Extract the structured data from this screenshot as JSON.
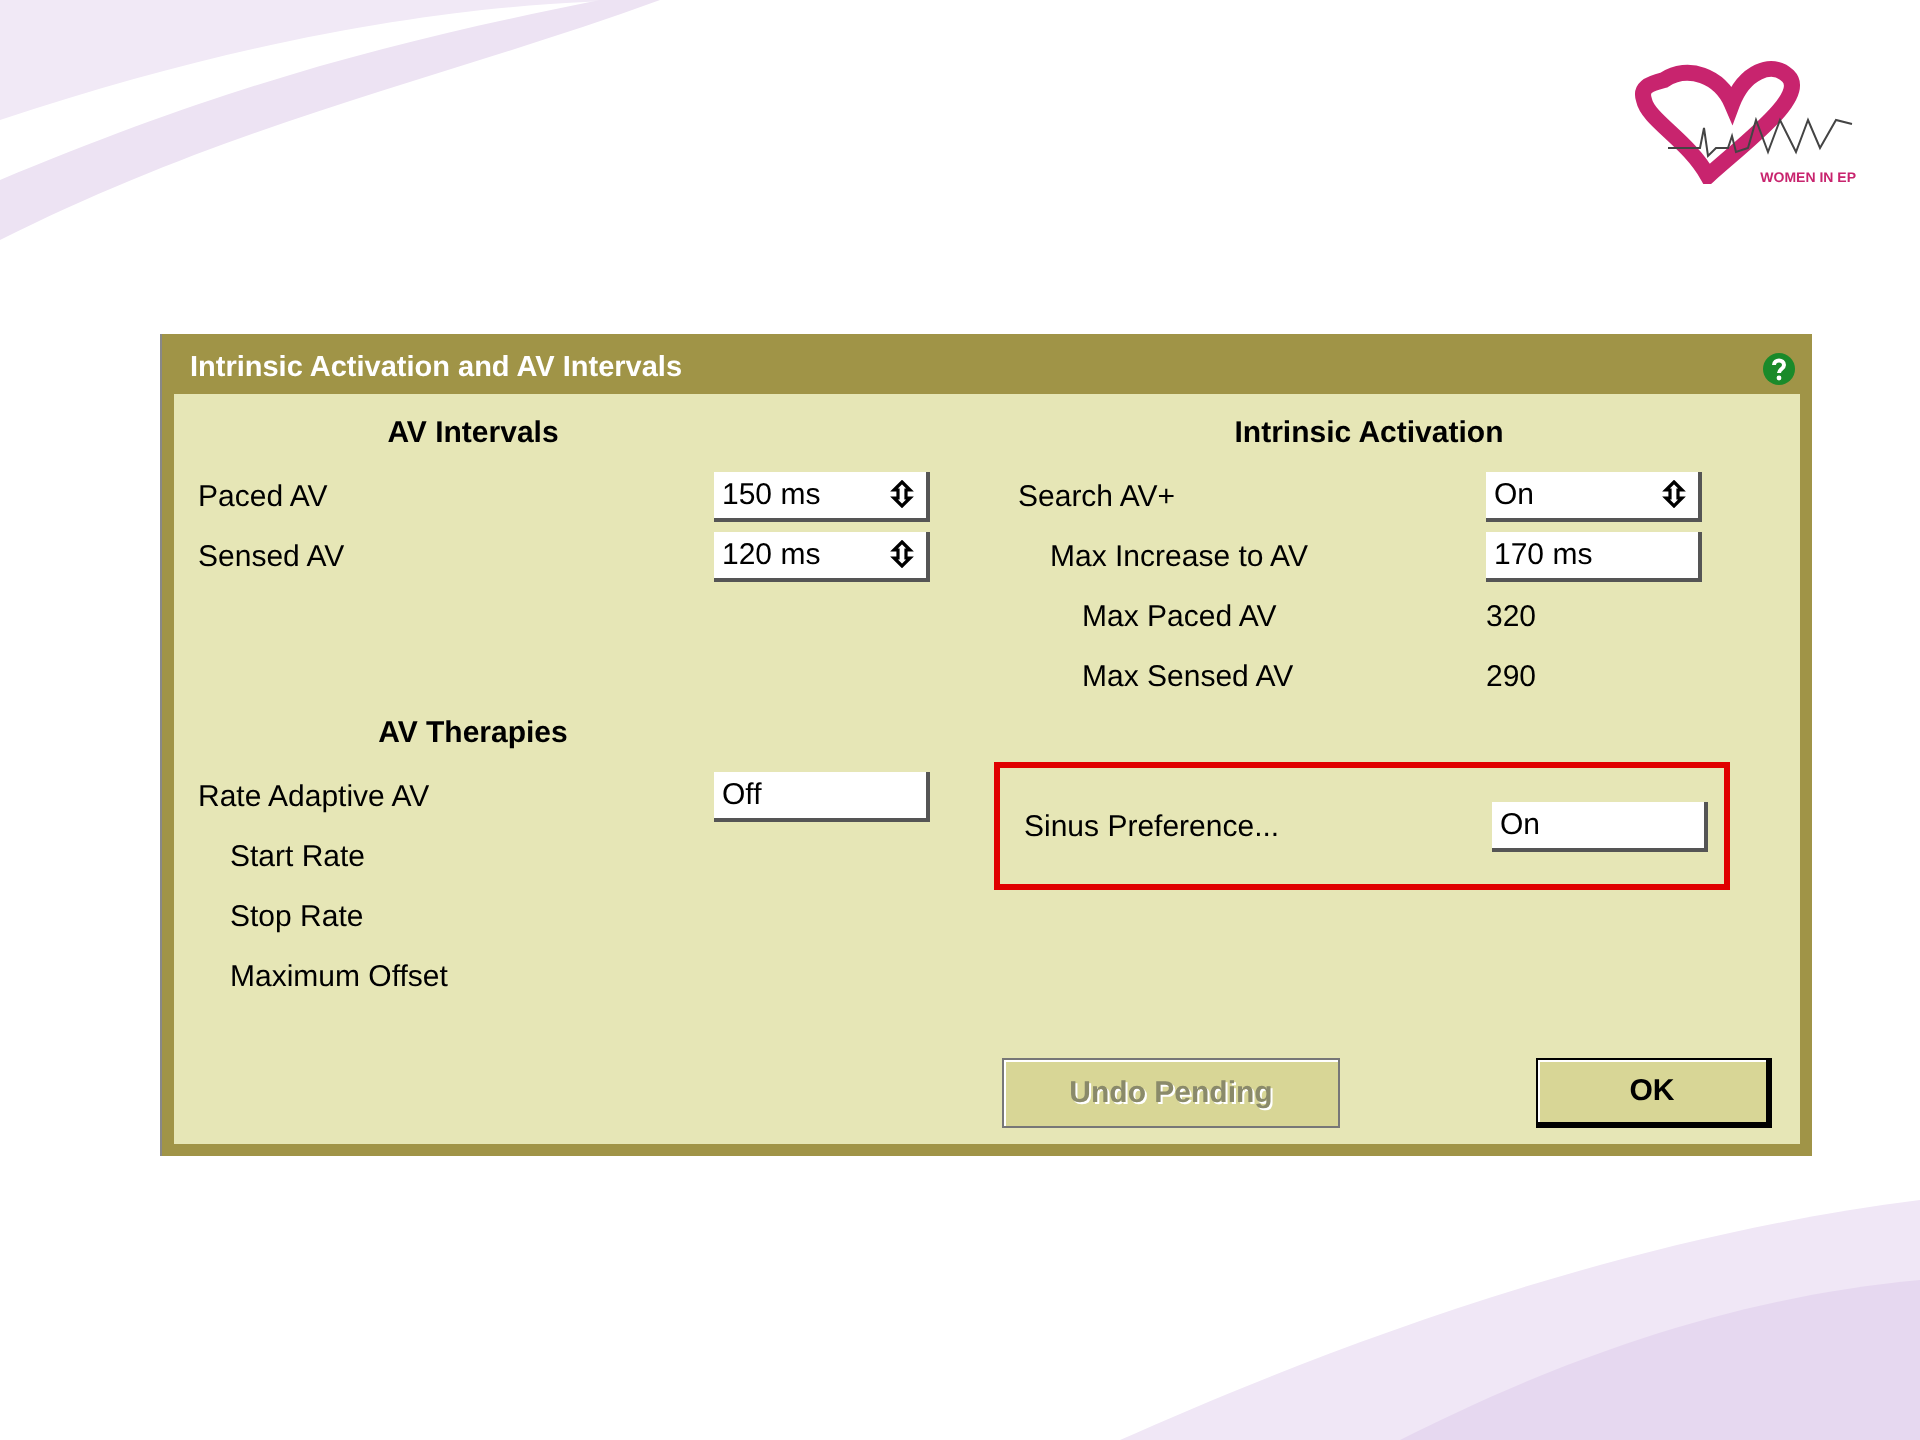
{
  "logo": {
    "caption": "WOMEN IN EP"
  },
  "window": {
    "title": "Intrinsic Activation and AV Intervals",
    "help": true
  },
  "columns": [
    {
      "groups": [
        {
          "heading": "AV Intervals",
          "highlighted": false,
          "rows": [
            {
              "kind": "field",
              "label": "Paced AV",
              "value": "150 ms",
              "spinner": true
            },
            {
              "kind": "field",
              "label": "Sensed AV",
              "value": "120 ms",
              "spinner": true
            }
          ]
        },
        {
          "heading": "AV Therapies",
          "highlighted": false,
          "rows": [
            {
              "kind": "field",
              "label": "Rate Adaptive AV",
              "value": "Off",
              "spinner": false,
              "children": [
                {
                  "kind": "label",
                  "label": "Start Rate"
                },
                {
                  "kind": "label",
                  "label": "Stop Rate"
                },
                {
                  "kind": "label",
                  "label": "Maximum Offset"
                }
              ]
            }
          ]
        }
      ]
    },
    {
      "groups": [
        {
          "heading": "Intrinsic Activation",
          "highlighted": false,
          "rows": [
            {
              "kind": "field",
              "label": "Search AV+",
              "value": "On",
              "spinner": true,
              "children": [
                {
                  "kind": "field",
                  "label": "Max Increase to AV",
                  "value": "170 ms",
                  "spinner": false,
                  "children": [
                    {
                      "kind": "readout",
                      "label": "Max Paced AV",
                      "value": "320"
                    },
                    {
                      "kind": "readout",
                      "label": "Max Sensed AV",
                      "value": "290"
                    }
                  ]
                }
              ]
            }
          ]
        },
        {
          "highlighted": true,
          "rows": [
            {
              "kind": "field",
              "label": "Sinus Preference...",
              "value": "On",
              "spinner": false
            }
          ]
        }
      ]
    }
  ],
  "buttons": [
    {
      "label": "Undo Pending",
      "disabled": true
    },
    {
      "label": "OK",
      "disabled": false
    }
  ]
}
